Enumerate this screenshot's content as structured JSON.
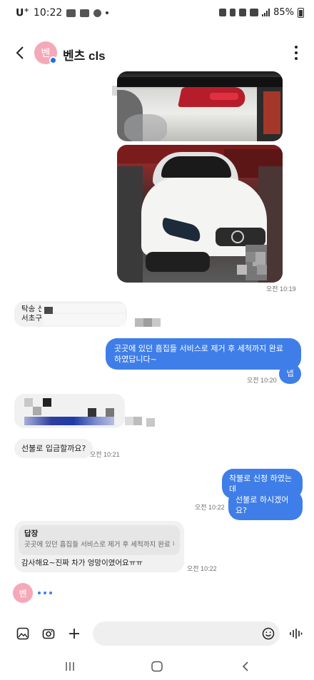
{
  "status_bar": {
    "carrier": "U",
    "carrier_sup": "+",
    "time": "10:22",
    "battery": "85%"
  },
  "header": {
    "contact_name": "벤츠 cls",
    "avatar_initial": "벤"
  },
  "messages": [
    {
      "id": "photos",
      "direction": "in",
      "time": "오전 10:19"
    },
    {
      "id": "m1",
      "direction": "in",
      "lines": [
        "탁송 신",
        "서초구"
      ]
    },
    {
      "id": "m2",
      "direction": "out",
      "text": "곳곳에 있던 흠집들 서비스로 제거 후 세척까지 완료 하였답니다~"
    },
    {
      "id": "m3",
      "direction": "out",
      "text": "넵",
      "time": "오전 10:20"
    },
    {
      "id": "m4",
      "direction": "in",
      "text": "선불로 입금할까요?",
      "time": "오전 10:21"
    },
    {
      "id": "m5",
      "direction": "out",
      "text": "착불로 신청 하였는데"
    },
    {
      "id": "m6",
      "direction": "out",
      "text": "선불로 하시겠어요?",
      "time": "오전 10:22"
    },
    {
      "id": "m7",
      "direction": "in",
      "reply_title": "답장",
      "reply_quote": "곳곳에 있던 흠집들 서비스로 제거 후 세척까지 완료 하...",
      "text": "감사해요~진짜 차가 엉망이였어요ㅠㅠ",
      "time": "오전 10:22"
    }
  ],
  "typing_avatar_initial": "벤",
  "icons": {
    "back": "back-arrow-icon",
    "more": "more-vertical-icon",
    "gallery": "gallery-icon",
    "camera": "camera-icon",
    "add": "plus-icon",
    "emoji": "emoji-icon",
    "voice": "voice-icon"
  },
  "colors": {
    "outgoing_bubble": "#3f7ee8",
    "incoming_bubble": "#f1f1f1",
    "avatar": "#f5a9b8"
  }
}
